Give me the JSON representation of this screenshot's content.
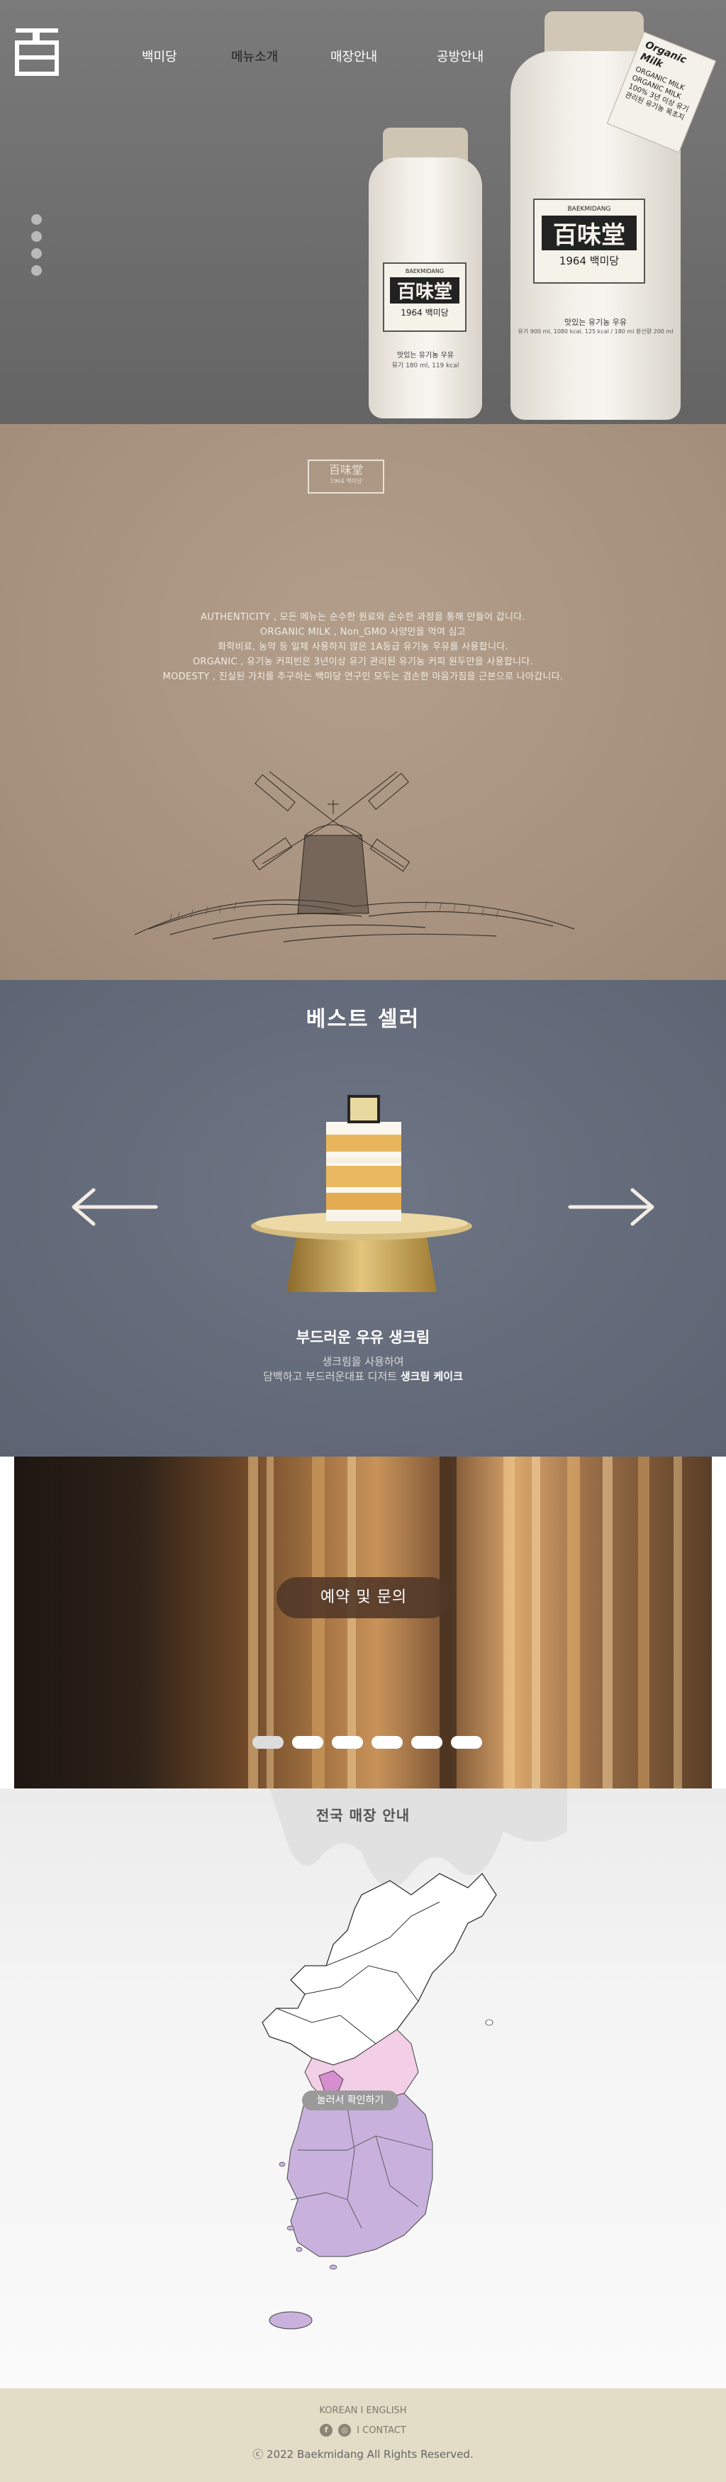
{
  "nav": {
    "logo_glyph": "百",
    "items": [
      {
        "label": "백미당",
        "active": false
      },
      {
        "label": "메뉴소개",
        "active": true
      },
      {
        "label": "매장안내",
        "active": false
      },
      {
        "label": "공방안내",
        "active": false
      }
    ],
    "slide_count": 4
  },
  "hero": {
    "small_bottle": {
      "brand_en": "BAEKMIDANG",
      "brand_hanja": "百味堂",
      "year": "1964 백미당",
      "note": "맛있는 유기농 우유",
      "info": "유기 180 ml, 119 kcal"
    },
    "large_bottle": {
      "brand_en": "BAEKMIDANG",
      "brand_hanja": "百味堂",
      "year": "1964 백미당",
      "note": "맛있는 유기농 우유",
      "info": "유기 900 ml, 1080 kcal, 125 kcal / 180 ml 환산량 200 ml",
      "tag_title": "Organic Milk",
      "tag_text": "ORGANIC MILK ORGANIC MILK 100% 3년 이상 유기 관리된 유기농 목초지"
    }
  },
  "intro": {
    "logo_hanja": "百味堂",
    "logo_sub": "1964 백미당",
    "lines": [
      "AUTHENTICITY , 모든 메뉴는 순수한 원료와 순수한 과정을 통해 만들어 갑니다.",
      "ORGANIC MILK , Non_GMO 사양만을 먹여 심고",
      "화학비료, 농약 등 일체 사용하지 않은 1A등급 유기농 우유를 사용합니다.",
      "ORGANIC , 유기농 커피빈은 3년이상 유기 관리된 유기농 커피 원두만을 사용합니다.",
      "MODESTY , 진실된 가치를 추구하는 백미당 연구인 모두는 겸손한 마음가짐을 근본으로 나아갑니다."
    ]
  },
  "best": {
    "title": "베스트 셀러",
    "product_name": "부드러운 우유 생크림",
    "desc_line1": "생크림을 사용하여",
    "desc_line2_prefix": "담백하고 부드러운대표 디저트 ",
    "desc_line2_bold": "생크림 케이크",
    "cake_badge": "百味堂"
  },
  "reserve": {
    "button_label": "예약 및 문의",
    "pages": [
      {
        "active": true
      },
      {
        "active": false
      },
      {
        "active": false
      },
      {
        "active": false
      },
      {
        "active": false
      },
      {
        "active": false
      }
    ]
  },
  "stores": {
    "title": "전국 매장 안내",
    "hint": "눌러서 확인하기",
    "colors": {
      "north": "#ffffff",
      "seoul": "#d78ed0",
      "gyeonggi": "#f2cfe6",
      "south": "#c8b2dd"
    }
  },
  "footer": {
    "lang_korean": "KOREAN",
    "lang_sep": " I ",
    "lang_english": "ENGLISH",
    "facebook": "f",
    "instagram": "◎",
    "contact": "I CONTACT",
    "copyright": "ⓒ 2022 Baekmidang All Rights Reserved."
  }
}
